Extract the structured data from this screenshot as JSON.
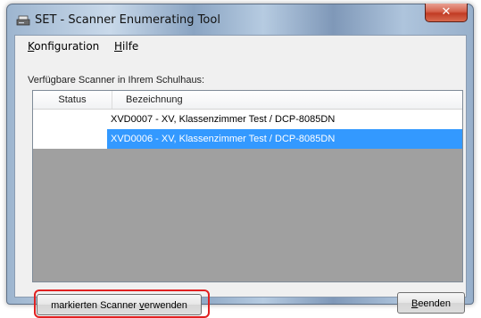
{
  "window": {
    "title": "SET - Scanner Enumerating Tool",
    "close_glyph": "✕"
  },
  "menu": {
    "items": [
      {
        "prefix": "",
        "accel": "K",
        "rest": "onfiguration"
      },
      {
        "prefix": "",
        "accel": "H",
        "rest": "ilfe"
      }
    ]
  },
  "scanner_list": {
    "label": "Verfügbare Scanner in Ihrem Schulhaus:",
    "columns": [
      "Status",
      "Bezeichnung"
    ],
    "rows": [
      {
        "status": "",
        "name": "XVD0007 - XV, Klassenzimmer Test / DCP-8085DN",
        "selected": false
      },
      {
        "status": "",
        "name": "XVD0006 - XV, Klassenzimmer Test / DCP-8085DN",
        "selected": true
      }
    ]
  },
  "buttons": {
    "use_prefix": "markierten Scanner ",
    "use_accel": "v",
    "use_rest": "erwenden",
    "quit_accel": "B",
    "quit_rest": "eenden"
  },
  "colors": {
    "selection": "#3399ff",
    "highlight_box": "#e02020",
    "close_button": "#c13b24"
  }
}
